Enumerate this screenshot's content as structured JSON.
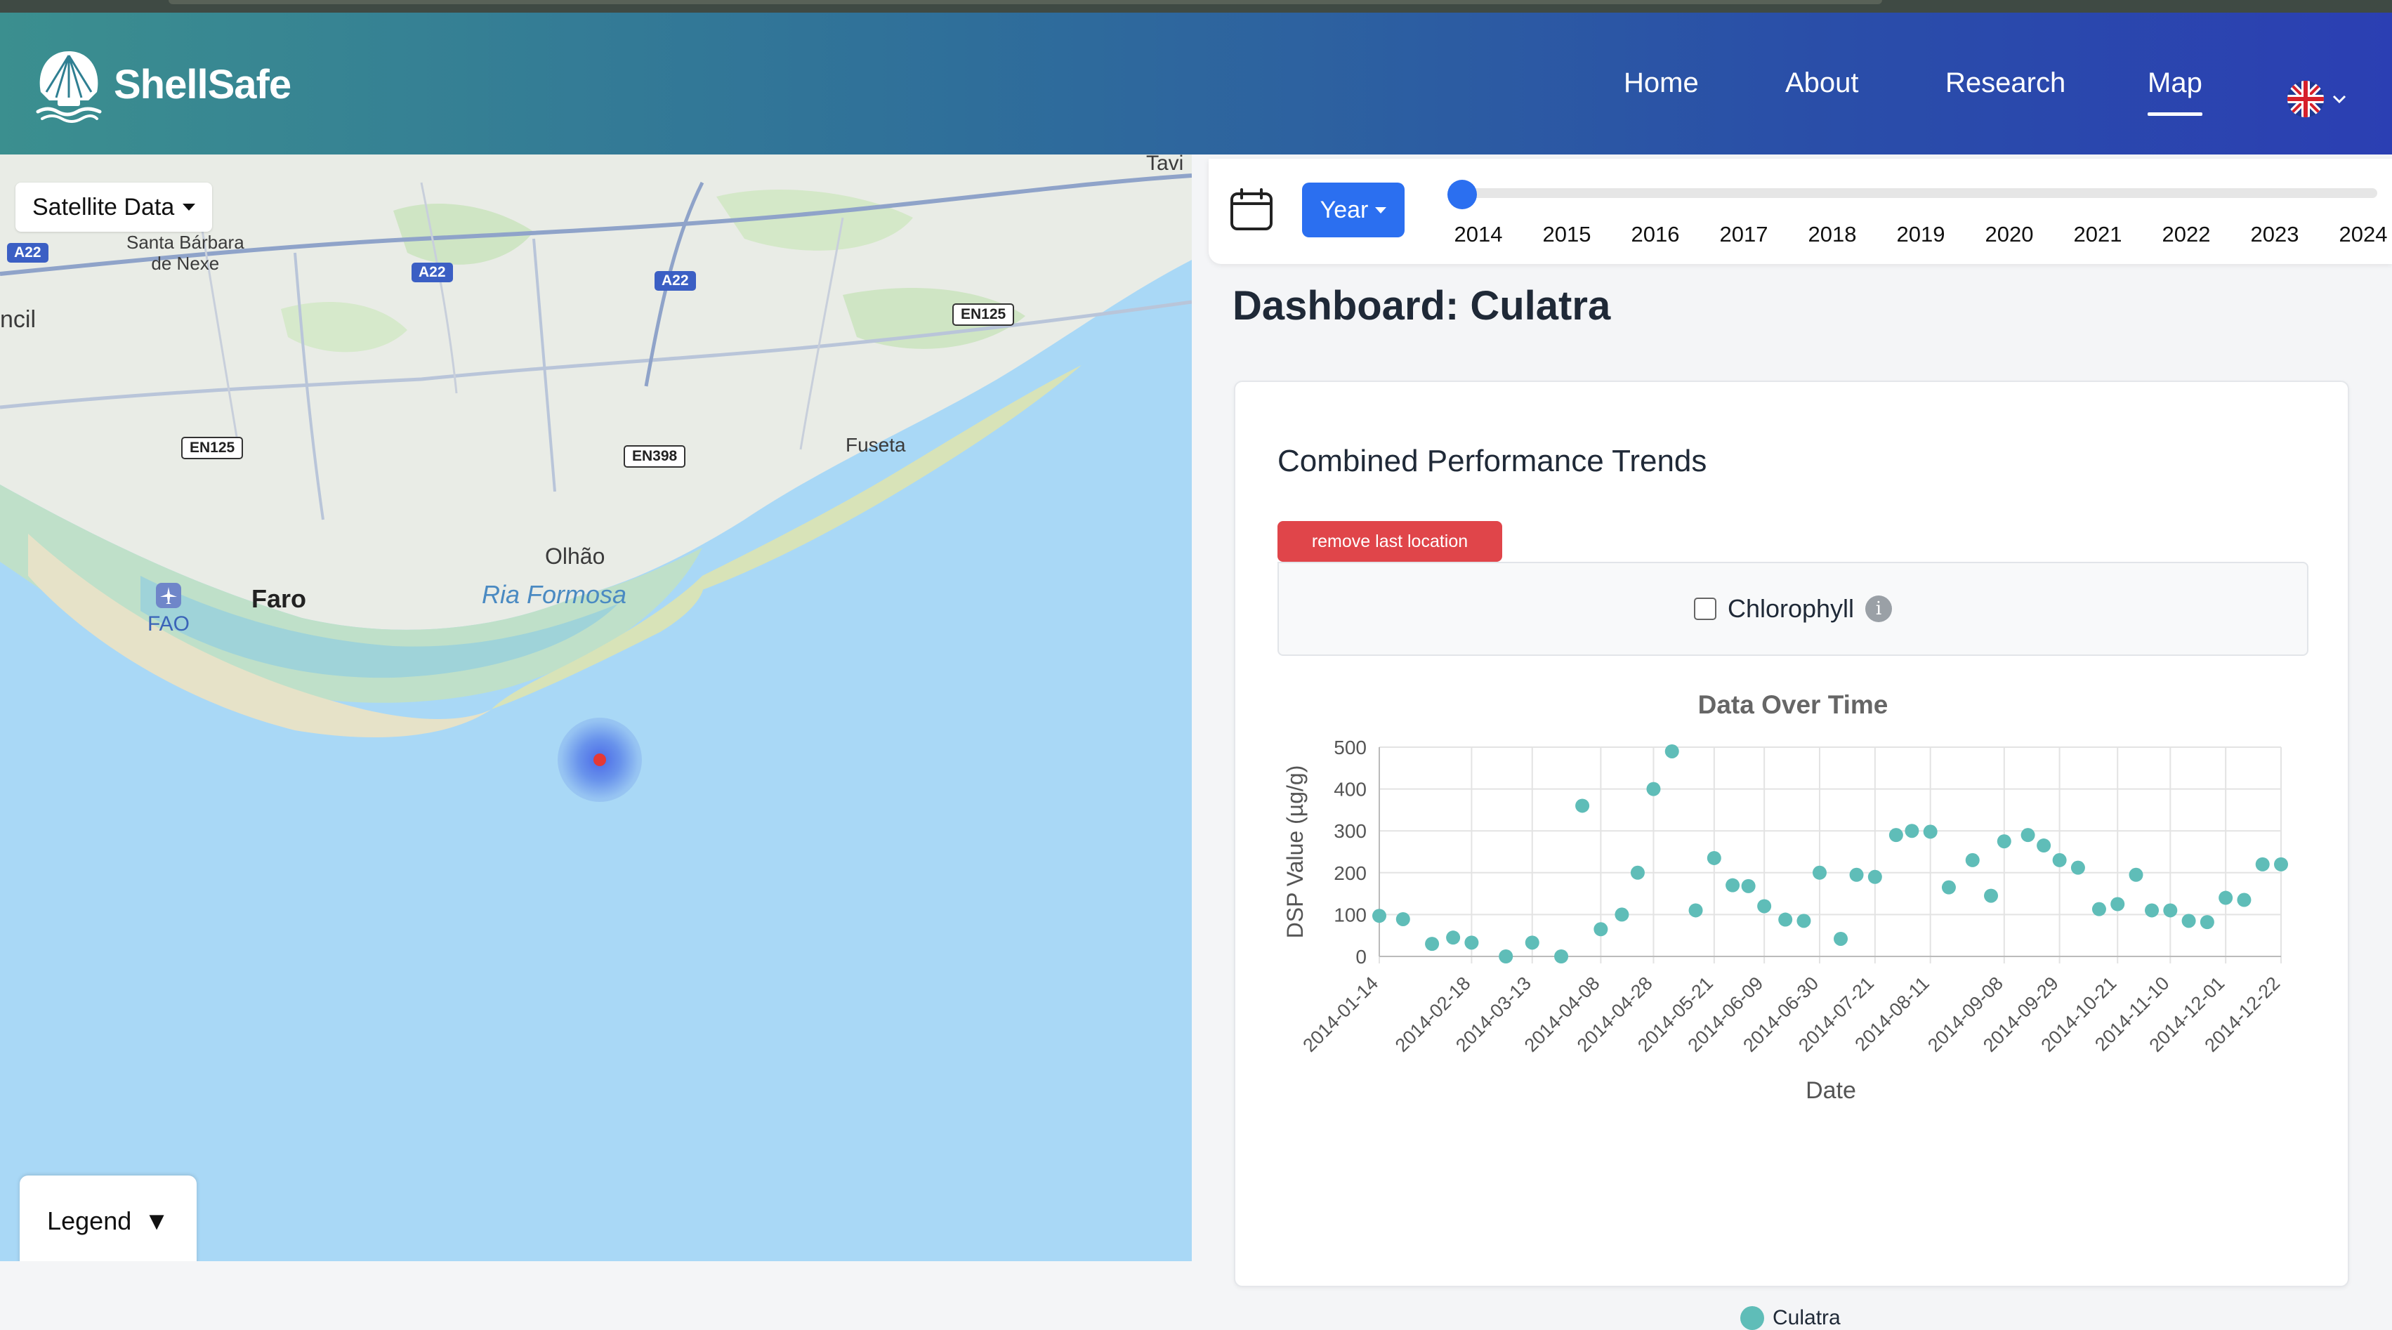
{
  "brand": {
    "name": "ShellSafe",
    "logo_icon": "shell-icon"
  },
  "nav": {
    "items": [
      {
        "label": "Home",
        "active": false
      },
      {
        "label": "About",
        "active": false
      },
      {
        "label": "Research",
        "active": false
      },
      {
        "label": "Map",
        "active": true
      }
    ],
    "language_icon": "uk-flag-icon"
  },
  "map": {
    "layer_button": "Satellite Data",
    "legend_button": "Legend",
    "legend_arrow": "▼",
    "labels": {
      "faro": "Faro",
      "olhao": "Olhão",
      "ria_formosa": "Ria Formosa",
      "fuseta": "Fuseta",
      "santa_barbara": "Santa Bárbara\nde Nexe",
      "fao": "FAO",
      "tavira": "Tavi",
      "loule": "ncil"
    },
    "roads": [
      "A22",
      "A22",
      "A22",
      "EN125",
      "EN125",
      "EN398"
    ],
    "marker_color": "#e53935"
  },
  "timebar": {
    "mode_button": "Year",
    "years": [
      "2014",
      "2015",
      "2016",
      "2017",
      "2018",
      "2019",
      "2020",
      "2021",
      "2022",
      "2023",
      "2024"
    ],
    "selected_year": "2014"
  },
  "dashboard": {
    "title": "Dashboard: Culatra",
    "card_title": "Combined Performance Trends",
    "remove_button": "remove last location",
    "metric_label": "Chlorophyll",
    "metric_checked": false
  },
  "chart_data": {
    "type": "scatter",
    "title": "Data Over Time",
    "xlabel": "Date",
    "ylabel": "DSP Value (µg/g)",
    "ylim": [
      0,
      500
    ],
    "yticks": [
      0,
      100,
      200,
      300,
      400,
      500
    ],
    "xticks": [
      "2014-01-14",
      "2014-02-18",
      "2014-03-13",
      "2014-04-08",
      "2014-04-28",
      "2014-05-21",
      "2014-06-09",
      "2014-06-30",
      "2014-07-21",
      "2014-08-11",
      "2014-09-08",
      "2014-09-29",
      "2014-10-21",
      "2014-11-10",
      "2014-12-01",
      "2014-12-22"
    ],
    "grid": true,
    "legend_position": "bottom",
    "series": [
      {
        "name": "Culatra",
        "color": "#5fbdb8",
        "x": [
          "2014-01-14",
          "2014-01-23",
          "2014-02-03",
          "2014-02-11",
          "2014-02-18",
          "2014-03-03",
          "2014-03-13",
          "2014-03-24",
          "2014-04-01",
          "2014-04-08",
          "2014-04-16",
          "2014-04-22",
          "2014-04-28",
          "2014-05-05",
          "2014-05-14",
          "2014-05-21",
          "2014-05-28",
          "2014-06-03",
          "2014-06-09",
          "2014-06-17",
          "2014-06-24",
          "2014-06-30",
          "2014-07-08",
          "2014-07-14",
          "2014-07-21",
          "2014-07-29",
          "2014-08-04",
          "2014-08-11",
          "2014-08-18",
          "2014-08-27",
          "2014-09-03",
          "2014-09-08",
          "2014-09-17",
          "2014-09-23",
          "2014-09-29",
          "2014-10-06",
          "2014-10-14",
          "2014-10-21",
          "2014-10-28",
          "2014-11-03",
          "2014-11-10",
          "2014-11-17",
          "2014-11-24",
          "2014-12-01",
          "2014-12-08",
          "2014-12-15",
          "2014-12-22"
        ],
        "y": [
          97,
          89,
          30,
          45,
          33,
          0,
          33,
          0,
          360,
          65,
          100,
          200,
          400,
          490,
          110,
          235,
          170,
          168,
          120,
          88,
          85,
          200,
          42,
          195,
          190,
          290,
          300,
          298,
          165,
          230,
          145,
          275,
          290,
          265,
          230,
          212,
          113,
          125,
          195,
          110,
          110,
          85,
          82,
          140,
          135,
          220,
          220
        ]
      }
    ]
  }
}
